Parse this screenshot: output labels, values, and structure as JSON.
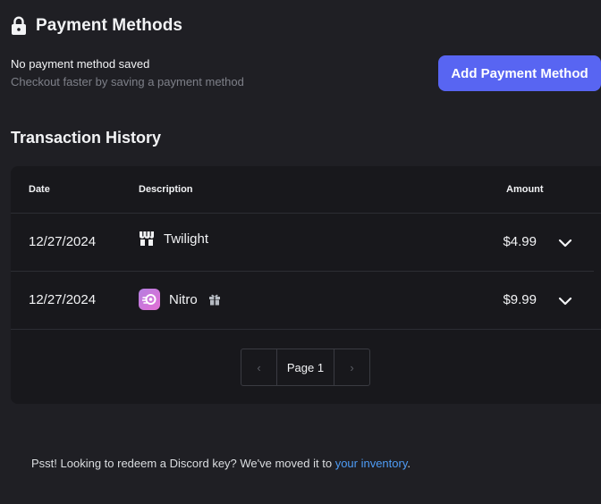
{
  "payment_methods": {
    "title": "Payment Methods",
    "icon": "lock-icon",
    "status": "No payment method saved",
    "hint": "Checkout faster by saving a payment method",
    "add_button": "Add Payment Method"
  },
  "transaction_history": {
    "title": "Transaction History",
    "columns": [
      "Date",
      "Description",
      "Amount"
    ],
    "rows": [
      {
        "date": "12/27/2024",
        "icon": "shop-icon",
        "description": "Twilight",
        "amount": "$4.99"
      },
      {
        "date": "12/27/2024",
        "icon": "nitro-icon",
        "description": "Nitro",
        "extra_icon": "gift-icon",
        "amount": "$9.99"
      }
    ],
    "pagination": {
      "prev": "‹",
      "page_label": "Page 1",
      "next": "›"
    }
  },
  "footer": {
    "text": "Psst! Looking to redeem a Discord key? We've moved it to ",
    "link": "your inventory",
    "suffix": "."
  },
  "colors": {
    "background": "#1f1f24",
    "card": "#18181c",
    "accent": "#5865f2",
    "link": "#4e9cf5",
    "muted": "#7e8089"
  }
}
